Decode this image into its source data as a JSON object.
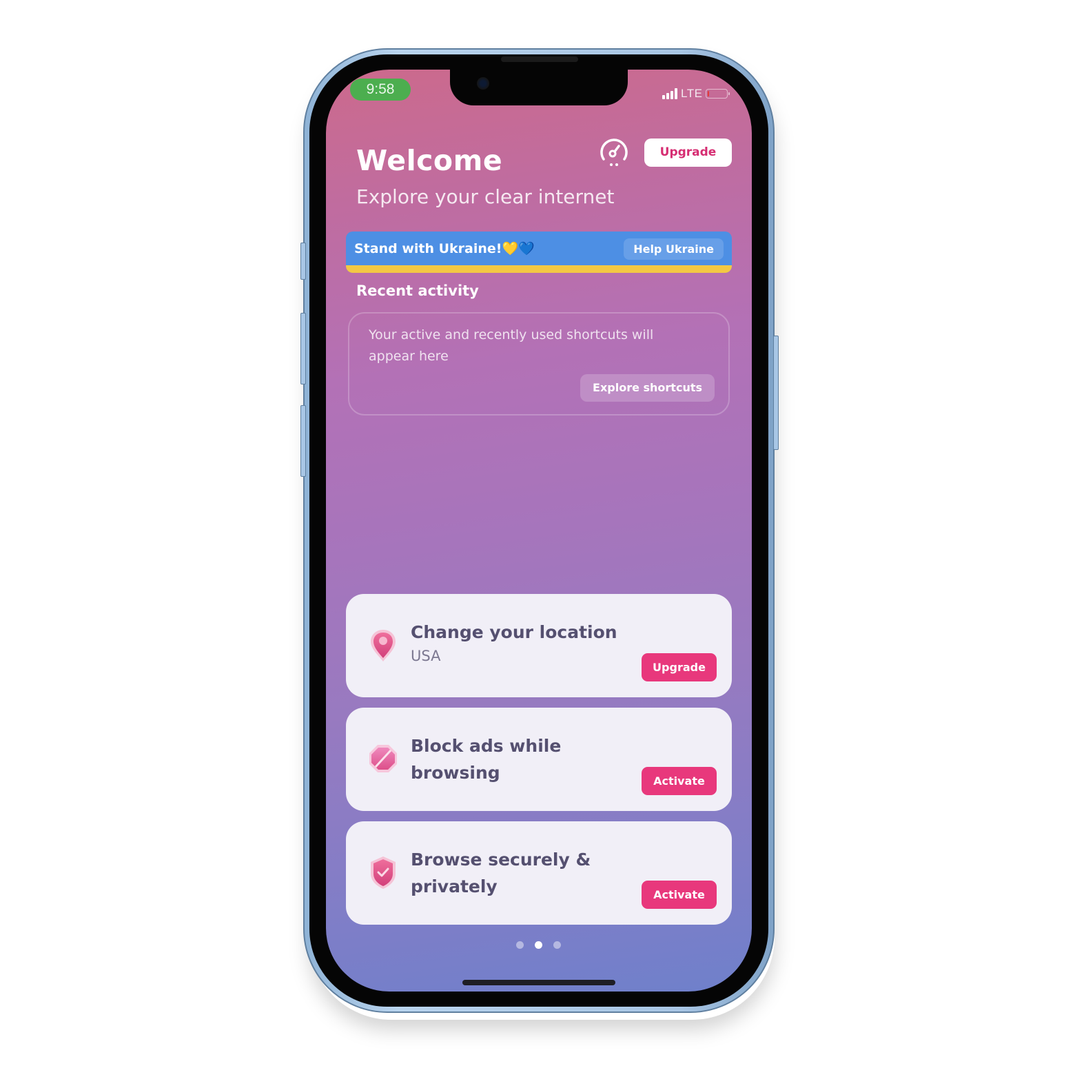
{
  "status_bar": {
    "time": "9:58",
    "network": "LTE",
    "signal_bars": 4,
    "battery_level": 0.08,
    "time_pill_color": "#4cae4f",
    "battery_color": "#e23b3b"
  },
  "header": {
    "title": "Welcome",
    "subtitle": "Explore your clear internet",
    "speed_icon": "speedometer-icon",
    "upgrade_label": "Upgrade"
  },
  "banner": {
    "text": "Stand with Ukraine!💛💙",
    "button_label": "Help Ukraine",
    "blue": "#4d8fe4",
    "yellow": "#f3c844"
  },
  "recent_activity": {
    "title": "Recent activity",
    "empty_text": "Your active and recently used shortcuts will appear here",
    "button_label": "Explore shortcuts"
  },
  "features": [
    {
      "icon": "location-pin-icon",
      "title": "Change your location",
      "subtitle": "USA",
      "button_label": "Upgrade"
    },
    {
      "icon": "ad-block-icon",
      "title": "Block ads while browsing",
      "subtitle": "",
      "button_label": "Activate"
    },
    {
      "icon": "shield-check-icon",
      "title": "Browse securely & privately",
      "subtitle": "",
      "button_label": "Activate"
    }
  ],
  "pager": {
    "count": 3,
    "active_index": 1
  },
  "colors": {
    "accent": "#e8387c",
    "card_bg": "#f1eff7",
    "card_text": "#555070"
  }
}
